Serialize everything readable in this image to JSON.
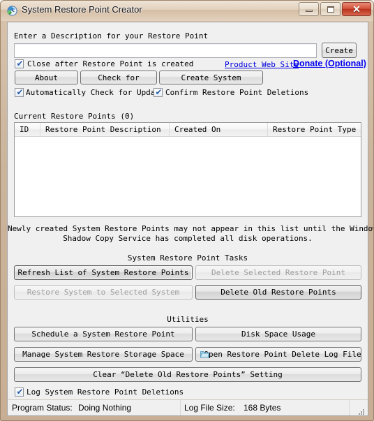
{
  "window": {
    "title": "System Restore Point Creator",
    "icon": "restore-point-clock-icon",
    "frame_color": "#cbb49c",
    "controls": {
      "minimize": "minimize-icon",
      "maximize": "maximize-icon",
      "close": "close-icon",
      "close_color": "#c0392b"
    }
  },
  "create_section": {
    "description_label": "Enter a Description for your Restore Point",
    "description_value": "",
    "description_placeholder": "",
    "create_button": "Create",
    "close_after_checkbox": {
      "label": "Close after Restore Point is created",
      "checked": true
    },
    "links": {
      "product_web_site": "Product Web Site",
      "donate": "Donate (Optional)",
      "link_color": "#0000dd"
    },
    "buttons": [
      {
        "label": "About",
        "enabled": true
      },
      {
        "label": "Check for",
        "enabled": true
      },
      {
        "label": "Create System",
        "enabled": true
      }
    ],
    "auto_update_checkbox": {
      "label": "Automatically Check for Updat",
      "checked": true
    },
    "confirm_deletions_checkbox": {
      "label": "Confirm Restore Point Deletions",
      "checked": true
    }
  },
  "list_section": {
    "group_label": "Current Restore Points (0)",
    "columns": [
      "ID",
      "Restore Point Description",
      "Created On",
      "Restore Point Type"
    ],
    "rows": [],
    "note_line1": "Newly created System Restore Points may not appear in this list until the Windows",
    "note_line2": "Shadow Copy Service has completed all disk operations."
  },
  "tasks_section": {
    "title": "System Restore Point Tasks",
    "buttons": [
      {
        "label": "Refresh List of System Restore Points",
        "enabled": true,
        "focused": true
      },
      {
        "label": "Delete Selected Restore Point",
        "enabled": false,
        "focused": false
      },
      {
        "label": "Restore System to Selected System",
        "enabled": false,
        "focused": false
      },
      {
        "label": "Delete Old Restore Points",
        "enabled": true,
        "focused": false
      }
    ]
  },
  "utilities_section": {
    "title": "Utilities",
    "buttons": [
      {
        "label": "Schedule a System Restore Point",
        "enabled": true,
        "icon": ""
      },
      {
        "label": "Disk Space Usage",
        "enabled": true,
        "icon": ""
      },
      {
        "label": "Manage System Restore Storage Space",
        "enabled": true,
        "icon": ""
      },
      {
        "label": "Open Restore Point Delete Log File",
        "enabled": true,
        "icon": "log-file-icon"
      },
      {
        "label": "Clear “Delete Old Restore Points” Setting",
        "enabled": true,
        "icon": ""
      }
    ]
  },
  "log_checkbox": {
    "label": "Log System Restore Point Deletions",
    "checked": true
  },
  "statusbar": {
    "program_status_label": "Program Status:",
    "program_status_value": "Doing Nothing",
    "log_file_size_label": "Log File Size:",
    "log_file_size_value": "168 Bytes"
  }
}
